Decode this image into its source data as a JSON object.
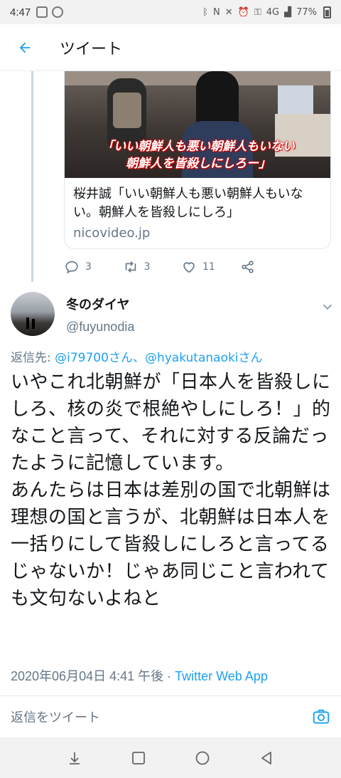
{
  "status_bar": {
    "time": "4:47",
    "battery": "77%",
    "network": "4G"
  },
  "header": {
    "title": "ツイート"
  },
  "quoted_card": {
    "caption_line1": "「いい朝鮮人も悪い朝鮮人もいない",
    "caption_line2": "朝鮮人を皆殺しにしろー」",
    "title": "桜井誠「いい朝鮮人も悪い朝鮮人もいない。朝鮮人を皆殺しにしろ」",
    "domain": "nicovideo.jp"
  },
  "parent_actions": {
    "replies": "3",
    "retweets": "3",
    "likes": "11"
  },
  "tweet": {
    "name": "冬のダイヤ",
    "handle": "@fuyunodia",
    "reply_prefix": "返信先: ",
    "reply_to": "@i79700さん、@hyakutanaokiさん",
    "text": "いやこれ北朝鮮が「日本人を皆殺しにしろ、核の炎で根絶やしにしろ！」的なこと言って、それに対する反論だったように記憶しています。\nあんたらは日本は差別の国で北朝鮮は理想の国と言うが、北朝鮮は日本人を一括りにして皆殺しにしろと言ってるじゃないか！じゃあ同じこと言われても文句ないよねと",
    "timestamp": "2020年06月04日 4:41 午後",
    "separator": " · ",
    "via": "Twitter Web App"
  },
  "composer": {
    "placeholder": "返信をツイート"
  },
  "colors": {
    "accent": "#1da1f2",
    "secondary_text": "#657786"
  }
}
